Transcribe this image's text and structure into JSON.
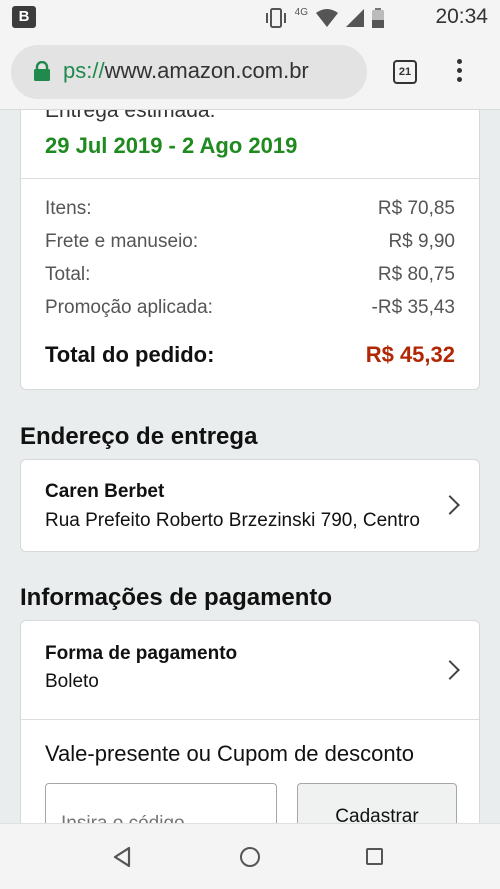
{
  "status_bar": {
    "app_icon_letter": "B",
    "network_label": "4G",
    "time": "20:34"
  },
  "browser": {
    "url_prefix": "ps://",
    "url_domain": "www.amazon.com.br",
    "tab_count": "21"
  },
  "order_summary": {
    "delivery_label": "Entrega estimada:",
    "delivery_date": "29 Jul 2019 - 2 Ago 2019",
    "rows": [
      {
        "label": "Itens:",
        "value": "R$ 70,85"
      },
      {
        "label": "Frete e manuseio:",
        "value": "R$ 9,90"
      },
      {
        "label": "Total:",
        "value": "R$ 80,75"
      },
      {
        "label": "Promoção aplicada:",
        "value": "-R$ 35,43"
      }
    ],
    "order_total_label": "Total do pedido:",
    "order_total_value": "R$ 45,32",
    "order_total_color": "#b12704",
    "delivery_color": "#1f8a1f"
  },
  "shipping": {
    "title": "Endereço de entrega",
    "name": "Caren Berbet",
    "address": "Rua Prefeito Roberto Brzezinski 790, Centro"
  },
  "payment": {
    "title": "Informações de pagamento",
    "method_label": "Forma de pagamento",
    "method_value": "Boleto",
    "coupon_title": "Vale-presente ou Cupom de desconto",
    "coupon_placeholder": "Insira o código",
    "coupon_button": "Cadastrar"
  },
  "icons": [
    "app-icon",
    "vibrate-icon",
    "wifi-icon",
    "signal-icon",
    "battery-icon",
    "lock-icon",
    "tabs-icon",
    "overflow-menu-icon",
    "chevron-right-icon",
    "back-icon",
    "home-icon",
    "recents-icon"
  ]
}
